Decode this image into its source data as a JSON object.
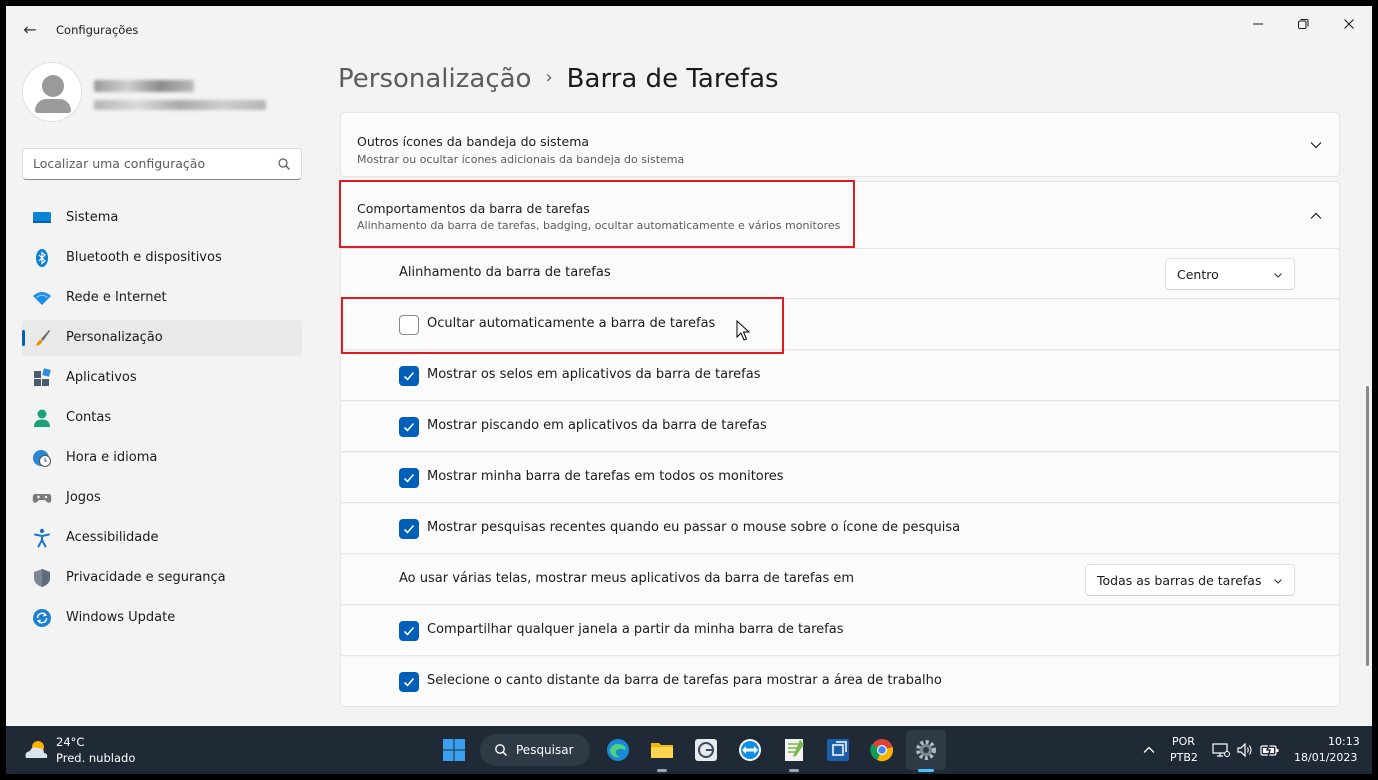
{
  "window": {
    "title": "Configurações",
    "back_glyph": "←",
    "min_glyph": "—",
    "close_glyph": "✕"
  },
  "sidebar": {
    "search_placeholder": "Localizar uma configuração",
    "items": [
      {
        "label": "Sistema",
        "icon": "monitor-icon"
      },
      {
        "label": "Bluetooth e dispositivos",
        "icon": "bluetooth-icon"
      },
      {
        "label": "Rede e Internet",
        "icon": "wifi-icon"
      },
      {
        "label": "Personalização",
        "icon": "brush-icon",
        "active": true
      },
      {
        "label": "Aplicativos",
        "icon": "apps-icon"
      },
      {
        "label": "Contas",
        "icon": "person-icon"
      },
      {
        "label": "Hora e idioma",
        "icon": "clock-globe-icon"
      },
      {
        "label": "Jogos",
        "icon": "gamepad-icon"
      },
      {
        "label": "Acessibilidade",
        "icon": "accessibility-icon"
      },
      {
        "label": "Privacidade e segurança",
        "icon": "shield-icon"
      },
      {
        "label": "Windows Update",
        "icon": "update-icon"
      }
    ]
  },
  "breadcrumb": {
    "parent": "Personalização",
    "separator": "›",
    "current": "Barra de Tarefas"
  },
  "sections": {
    "tray": {
      "title": "Outros ícones da bandeja do sistema",
      "subtitle": "Mostrar ou ocultar ícones adicionais da bandeja do sistema"
    },
    "behaviors": {
      "title": "Comportamentos da barra de tarefas",
      "subtitle": "Alinhamento da barra de tarefas, badging, ocultar automaticamente e vários monitores"
    }
  },
  "settings": {
    "alignment_label": "Alinhamento da barra de tarefas",
    "alignment_value": "Centro",
    "autohide_label": "Ocultar automaticamente a barra de tarefas",
    "badges_label": "Mostrar os selos em aplicativos da barra de tarefas",
    "flashing_label": "Mostrar piscando em aplicativos da barra de tarefas",
    "all_monitors_label": "Mostrar minha barra de tarefas em todos os monitores",
    "recent_searches_label": "Mostrar pesquisas recentes quando eu passar o mouse sobre o ícone de pesquisa",
    "multi_display_label": "Ao usar várias telas, mostrar meus aplicativos da barra de tarefas em",
    "multi_display_value": "Todas as barras de tarefas",
    "share_window_label": "Compartilhar qualquer janela a partir da minha barra de tarefas",
    "far_corner_label": "Selecione o canto distante da barra de tarefas para mostrar a área de trabalho"
  },
  "taskbar": {
    "temperature": "24°C",
    "weather": "Pred. nublado",
    "search_label": "Pesquisar",
    "lang1": "POR",
    "lang2": "PTB2",
    "time": "10:13",
    "date": "18/01/2023",
    "colors": {
      "background": "#202a36",
      "accent": "#005fb8"
    }
  }
}
